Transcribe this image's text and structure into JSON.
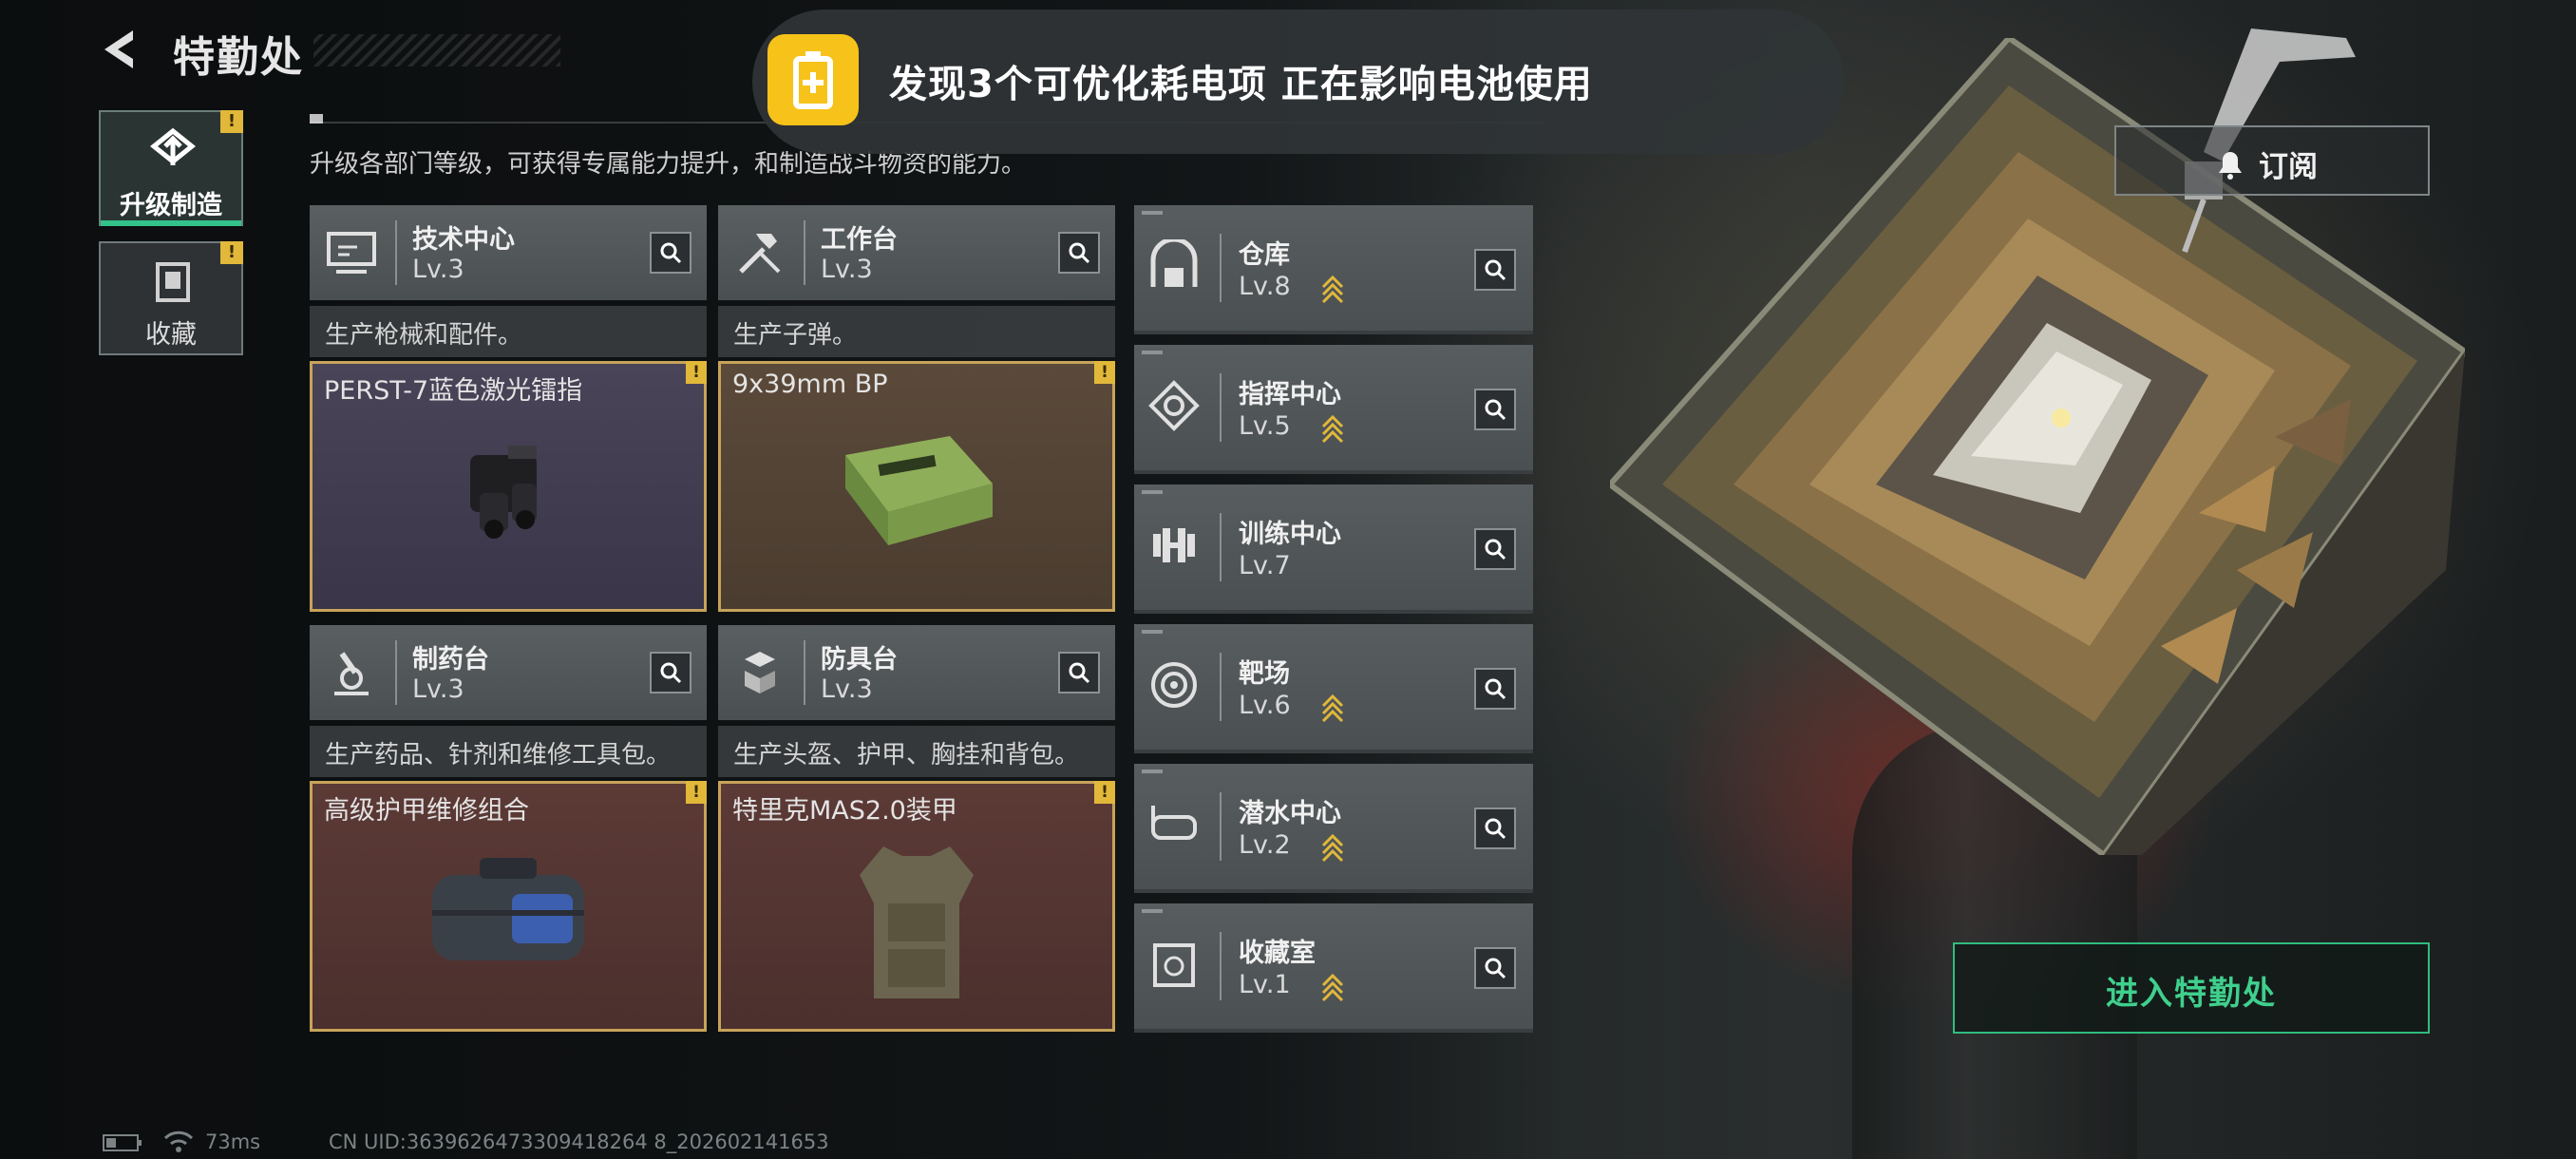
{
  "header": {
    "title": "特勤处",
    "subtitle": "升级各部门等级，可获得专属能力提升，和制造战斗物资的能力。"
  },
  "notification": {
    "text": "发现3个可优化耗电项  正在影响电池使用",
    "icon": "battery-saver-icon",
    "color": "#f7c31a"
  },
  "tabs": [
    {
      "label": "升级制造",
      "active": true,
      "badge": "!"
    },
    {
      "label": "收藏",
      "active": false,
      "badge": "!"
    }
  ],
  "stations": [
    {
      "name": "技术中心",
      "level": "Lv.3",
      "desc": "生产枪械和配件。",
      "item": "PERST-7蓝色激光镭指",
      "badge": "!"
    },
    {
      "name": "工作台",
      "level": "Lv.3",
      "desc": "生产子弹。",
      "item": "9x39mm BP",
      "badge": "!"
    },
    {
      "name": "制药台",
      "level": "Lv.3",
      "desc": "生产药品、针剂和维修工具包。",
      "item": "高级护甲维修组合",
      "badge": "!"
    },
    {
      "name": "防具台",
      "level": "Lv.3",
      "desc": "生产头盔、护甲、胸挂和背包。",
      "item": "特里克MAS2.0装甲",
      "badge": "!"
    }
  ],
  "facilities": [
    {
      "name": "仓库",
      "level": "Lv.8",
      "upgradable": true
    },
    {
      "name": "指挥中心",
      "level": "Lv.5",
      "upgradable": true
    },
    {
      "name": "训练中心",
      "level": "Lv.7",
      "upgradable": false
    },
    {
      "name": "靶场",
      "level": "Lv.6",
      "upgradable": true
    },
    {
      "name": "潜水中心",
      "level": "Lv.2",
      "upgradable": true
    },
    {
      "name": "收藏室",
      "level": "Lv.1",
      "upgradable": true
    }
  ],
  "subscribe_label": "订阅",
  "enter_label": "进入特勤处",
  "status": {
    "ping": "73ms",
    "uid": "CN UID:3639626473309418264 8_202602141653"
  },
  "colors": {
    "accent": "#33c28a",
    "gold": "#e1b83a",
    "notice": "#f7c31a"
  }
}
